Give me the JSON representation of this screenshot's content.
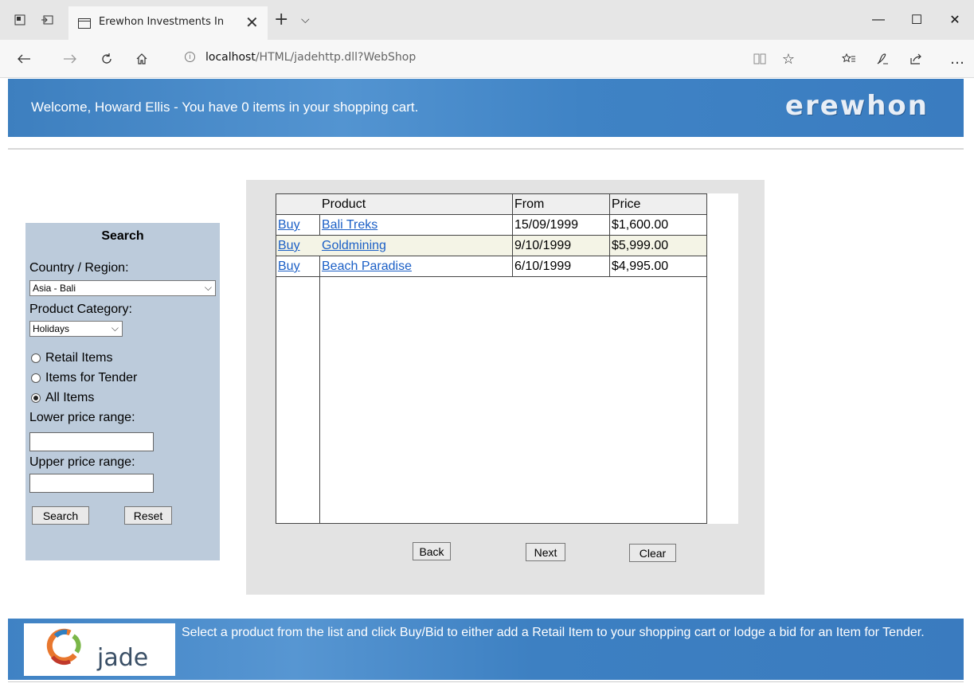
{
  "browser": {
    "tab_title": "Erewhon Investments In",
    "tab_close": "✕",
    "new_tab": "+",
    "tab_list": "⌵",
    "url_host": "localhost",
    "url_rest": "/HTML/jadehttp.dll?WebShop",
    "win_minimize": "—",
    "win_maximize": "☐",
    "win_close": "✕",
    "icons": [
      "set-aside-tabs-icon",
      "show-tabs-icon",
      "back-icon",
      "forward-icon",
      "refresh-icon",
      "home-icon",
      "reading-view-icon",
      "favorite-star-icon",
      "favorites-hub-icon",
      "notes-icon",
      "share-icon",
      "more-icon"
    ]
  },
  "header": {
    "welcome": "Welcome, Howard Ellis - You have 0 items in your shopping cart.",
    "logo": "erewhon"
  },
  "search": {
    "title": "Search",
    "country_label": "Country / Region:",
    "country_value": "Asia - Bali",
    "category_label": "Product Category:",
    "category_value": "Holidays",
    "radio_retail": "Retail Items",
    "radio_tender": "Items for Tender",
    "radio_all": "All Items",
    "selected_radio": "All Items",
    "lower_label": "Lower price range:",
    "upper_label": "Upper price range:",
    "lower_value": "",
    "upper_value": "",
    "search_button": "Search",
    "reset_button": "Reset"
  },
  "results": {
    "columns": [
      "",
      "Product",
      "From",
      "Price"
    ],
    "rows": [
      {
        "action": "Buy",
        "product": "Bali Treks",
        "from": "15/09/1999",
        "price": "$1,600.00"
      },
      {
        "action": "Buy",
        "product": "Goldmining",
        "from": "9/10/1999",
        "price": "$5,999.00"
      },
      {
        "action": "Buy",
        "product": "Beach Paradise",
        "from": "6/10/1999",
        "price": "$4,995.00"
      }
    ],
    "back_button": "Back",
    "next_button": "Next",
    "clear_button": "Clear"
  },
  "footer": {
    "logo_word": "jade",
    "message": "Select a product from the list and click Buy/Bid to either add a Retail Item to your shopping cart or lodge a bid for an Item for Tender."
  },
  "colors": {
    "banner_blue": "#4288c9",
    "search_panel": "#bccbdb",
    "results_bg": "#e3e3e3",
    "link": "#1b5fc6",
    "alt_row": "#f4f4e6"
  }
}
